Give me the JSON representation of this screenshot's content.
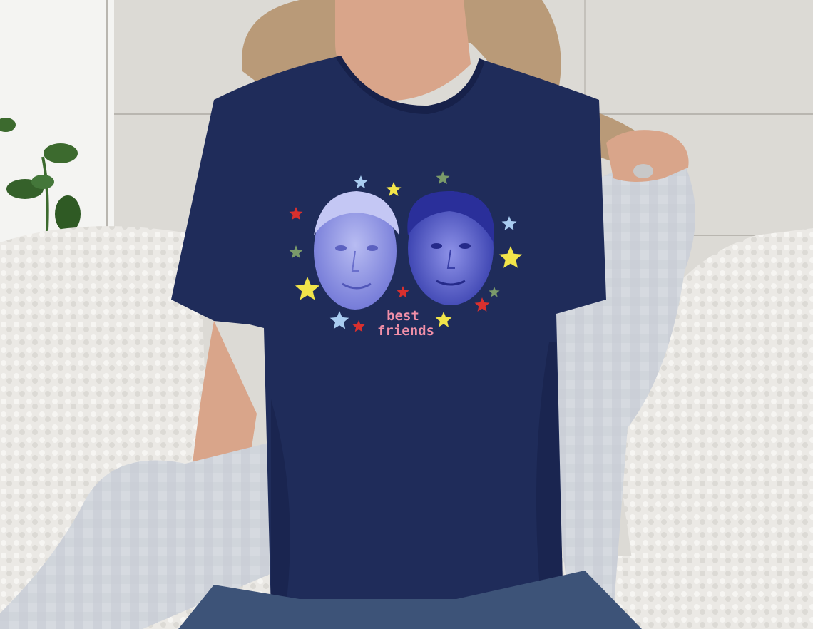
{
  "print": {
    "line1": "best",
    "line2": "friends"
  },
  "colors": {
    "wall": "#dcdad5",
    "wall_plank_line": "#b9b6b0",
    "shirt": "#1f2c5a",
    "shirt_shadow": "#17214a",
    "skin": "#d9a58a",
    "hair": "#b99a78",
    "cardigan": "#d4d8de",
    "cardigan_check": "#bfc4cc",
    "pillow": "#ecebe8",
    "sofa": "#e4e2de",
    "jeans": "#3d5378",
    "print_text": "#f08fa8",
    "face_left": "#9a9fe8",
    "face_right": "#4a52c8",
    "star_yellow": "#f2e54a",
    "star_red": "#d9302e",
    "star_lightblue": "#a9ccf0",
    "star_green": "#7a9a6a",
    "plant": "#3c6a2e"
  },
  "icons": [
    "star-icon",
    "plant"
  ]
}
